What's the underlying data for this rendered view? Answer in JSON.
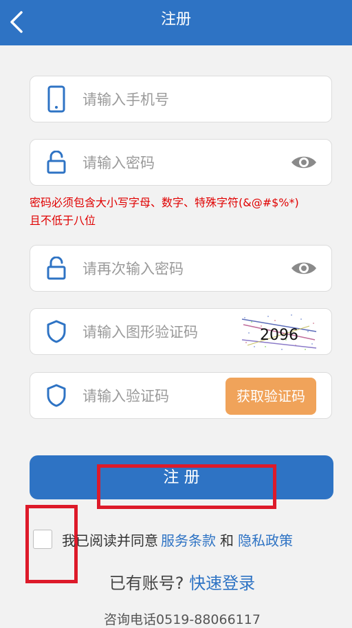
{
  "header": {
    "title": "注册"
  },
  "form": {
    "phone_placeholder": "请输入手机号",
    "password_placeholder": "请输入密码",
    "password_hint_line1": "密码必须包含大小写字母、数字、特殊字符(&@#$%*)",
    "password_hint_line2": "且不低于八位",
    "confirm_placeholder": "请再次输入密码",
    "captcha_placeholder": "请输入图形验证码",
    "captcha_text": "2096",
    "sms_placeholder": "请输入验证码",
    "get_code_label": "获取验证码"
  },
  "register_label": "注 册",
  "agreement": {
    "prefix": "我已阅读并同意",
    "terms": "服务条款",
    "and": "和",
    "privacy": "隐私政策"
  },
  "login": {
    "prompt": "已有账号?",
    "link": "快速登录"
  },
  "footer": {
    "phone": "咨询电话0519-88066117"
  },
  "colors": {
    "primary": "#2e73c4",
    "accent": "#f0a35a",
    "error": "#e00000",
    "highlight": "#dd1a2a"
  }
}
